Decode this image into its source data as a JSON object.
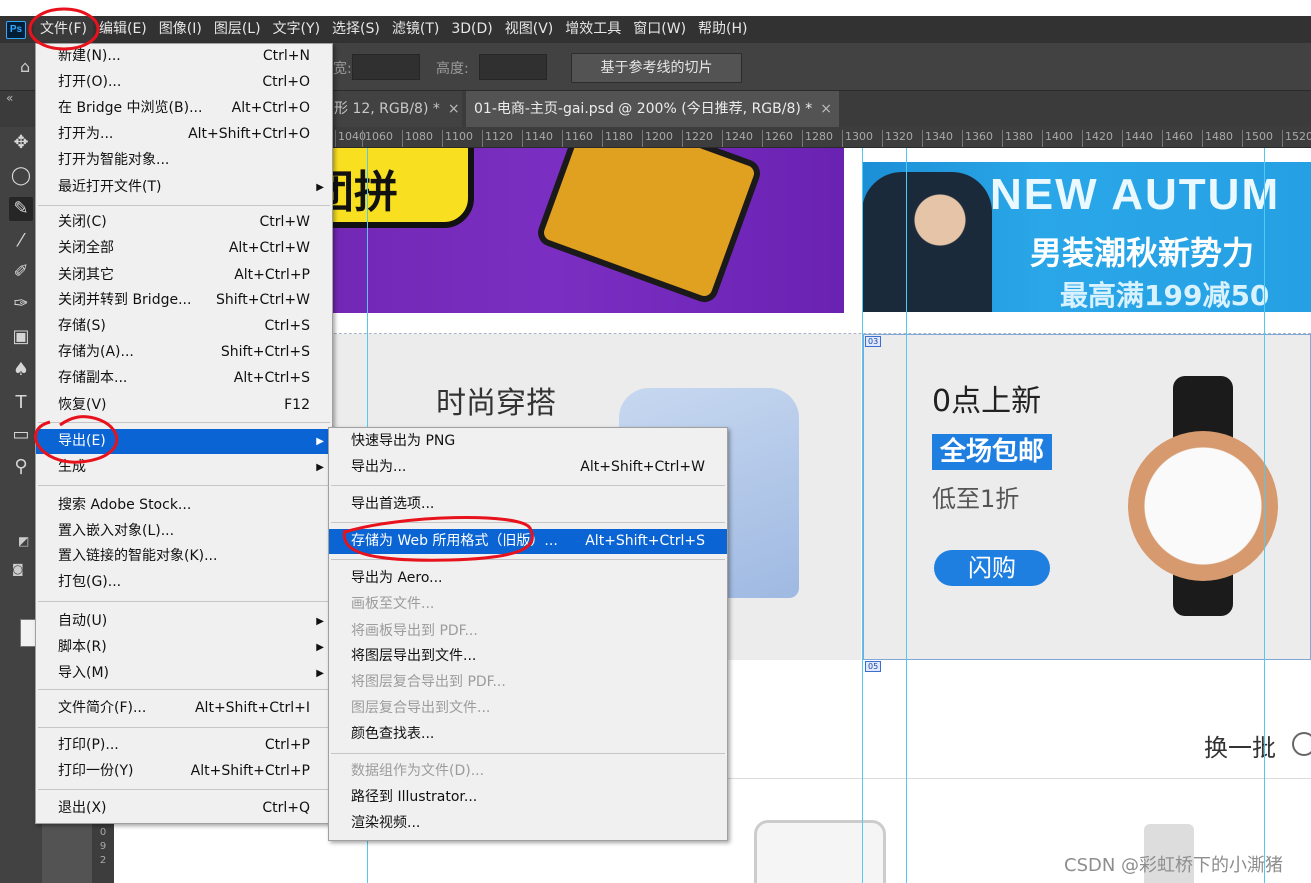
{
  "app": {
    "logo": "Ps"
  },
  "menubar": {
    "items": [
      "文件(F)",
      "编辑(E)",
      "图像(I)",
      "图层(L)",
      "文字(Y)",
      "选择(S)",
      "滤镜(T)",
      "3D(D)",
      "视图(V)",
      "增效工具",
      "窗口(W)",
      "帮助(H)"
    ]
  },
  "options": {
    "width_label": "宽:",
    "height_label": "高度:",
    "slice_button": "基于参考线的切片"
  },
  "tabs": [
    {
      "label": "形 12, RGB/8) *",
      "close": "×"
    },
    {
      "label": "01-电商-主页-gai.psd @ 200% (今日推荐, RGB/8) *",
      "close": "×"
    }
  ],
  "ruler": [
    "1040",
    "1060",
    "1080",
    "1100",
    "1120",
    "1140",
    "1160",
    "1180",
    "1200",
    "1220",
    "1240",
    "1260",
    "1280",
    "1300",
    "1320",
    "1340",
    "1360",
    "1380",
    "1400",
    "1420",
    "1440",
    "1460",
    "1480",
    "1500",
    "1520"
  ],
  "file_menu": {
    "items": [
      {
        "label": "新建(N)...",
        "shortcut": "Ctrl+N"
      },
      {
        "label": "打开(O)...",
        "shortcut": "Ctrl+O"
      },
      {
        "label": "在 Bridge 中浏览(B)...",
        "shortcut": "Alt+Ctrl+O"
      },
      {
        "label": "打开为...",
        "shortcut": "Alt+Shift+Ctrl+O"
      },
      {
        "label": "打开为智能对象...",
        "shortcut": ""
      },
      {
        "label": "最近打开文件(T)",
        "shortcut": ""
      },
      {
        "label": "关闭(C)",
        "shortcut": "Ctrl+W"
      },
      {
        "label": "关闭全部",
        "shortcut": "Alt+Ctrl+W"
      },
      {
        "label": "关闭其它",
        "shortcut": "Alt+Ctrl+P"
      },
      {
        "label": "关闭并转到 Bridge...",
        "shortcut": "Shift+Ctrl+W"
      },
      {
        "label": "存储(S)",
        "shortcut": "Ctrl+S"
      },
      {
        "label": "存储为(A)...",
        "shortcut": "Shift+Ctrl+S"
      },
      {
        "label": "存储副本...",
        "shortcut": "Alt+Ctrl+S"
      },
      {
        "label": "恢复(V)",
        "shortcut": "F12"
      },
      {
        "label": "导出(E)",
        "shortcut": ""
      },
      {
        "label": "生成",
        "shortcut": ""
      },
      {
        "label": "搜索 Adobe Stock...",
        "shortcut": ""
      },
      {
        "label": "置入嵌入对象(L)...",
        "shortcut": ""
      },
      {
        "label": "置入链接的智能对象(K)...",
        "shortcut": ""
      },
      {
        "label": "打包(G)...",
        "shortcut": ""
      },
      {
        "label": "自动(U)",
        "shortcut": ""
      },
      {
        "label": "脚本(R)",
        "shortcut": ""
      },
      {
        "label": "导入(M)",
        "shortcut": ""
      },
      {
        "label": "文件简介(F)...",
        "shortcut": "Alt+Shift+Ctrl+I"
      },
      {
        "label": "打印(P)...",
        "shortcut": "Ctrl+P"
      },
      {
        "label": "打印一份(Y)",
        "shortcut": "Alt+Shift+Ctrl+P"
      },
      {
        "label": "退出(X)",
        "shortcut": "Ctrl+Q"
      }
    ]
  },
  "export_menu": {
    "items": [
      {
        "label": "快速导出为 PNG",
        "shortcut": ""
      },
      {
        "label": "导出为...",
        "shortcut": "Alt+Shift+Ctrl+W"
      },
      {
        "label": "导出首选项...",
        "shortcut": ""
      },
      {
        "label": "存储为 Web 所用格式（旧版）...",
        "shortcut": "Alt+Shift+Ctrl+S"
      },
      {
        "label": "导出为 Aero...",
        "shortcut": ""
      },
      {
        "label": "画板至文件...",
        "shortcut": ""
      },
      {
        "label": "将画板导出到 PDF...",
        "shortcut": ""
      },
      {
        "label": "将图层导出到文件...",
        "shortcut": ""
      },
      {
        "label": "将图层复合导出到 PDF...",
        "shortcut": ""
      },
      {
        "label": "图层复合导出到文件...",
        "shortcut": ""
      },
      {
        "label": "颜色查找表...",
        "shortcut": ""
      },
      {
        "label": "数据组作为文件(D)...",
        "shortcut": ""
      },
      {
        "label": "路径到 Illustrator...",
        "shortcut": ""
      },
      {
        "label": "渲染视频...",
        "shortcut": ""
      }
    ]
  },
  "canvas": {
    "banner_left_text": "团拼",
    "banner_title": "NEW AUTUM",
    "banner_sub1": "男装潮秋新势力",
    "banner_sub2": "最高满199减50",
    "fashion_title": "时尚穿搭",
    "promo_title": "0点上新",
    "promo_badge": "全场包邮",
    "promo_sub": "低至1折",
    "promo_button": "闪购",
    "refresh": "换一批",
    "slice_tag_1": "03",
    "slice_tag_2": "05"
  },
  "vruler": [
    "0",
    "9",
    "2"
  ],
  "watermark": "CSDN @彩虹桥下的小澌猪",
  "colors": {
    "accent": "#0a64d4",
    "annotation": "#e8121c"
  }
}
